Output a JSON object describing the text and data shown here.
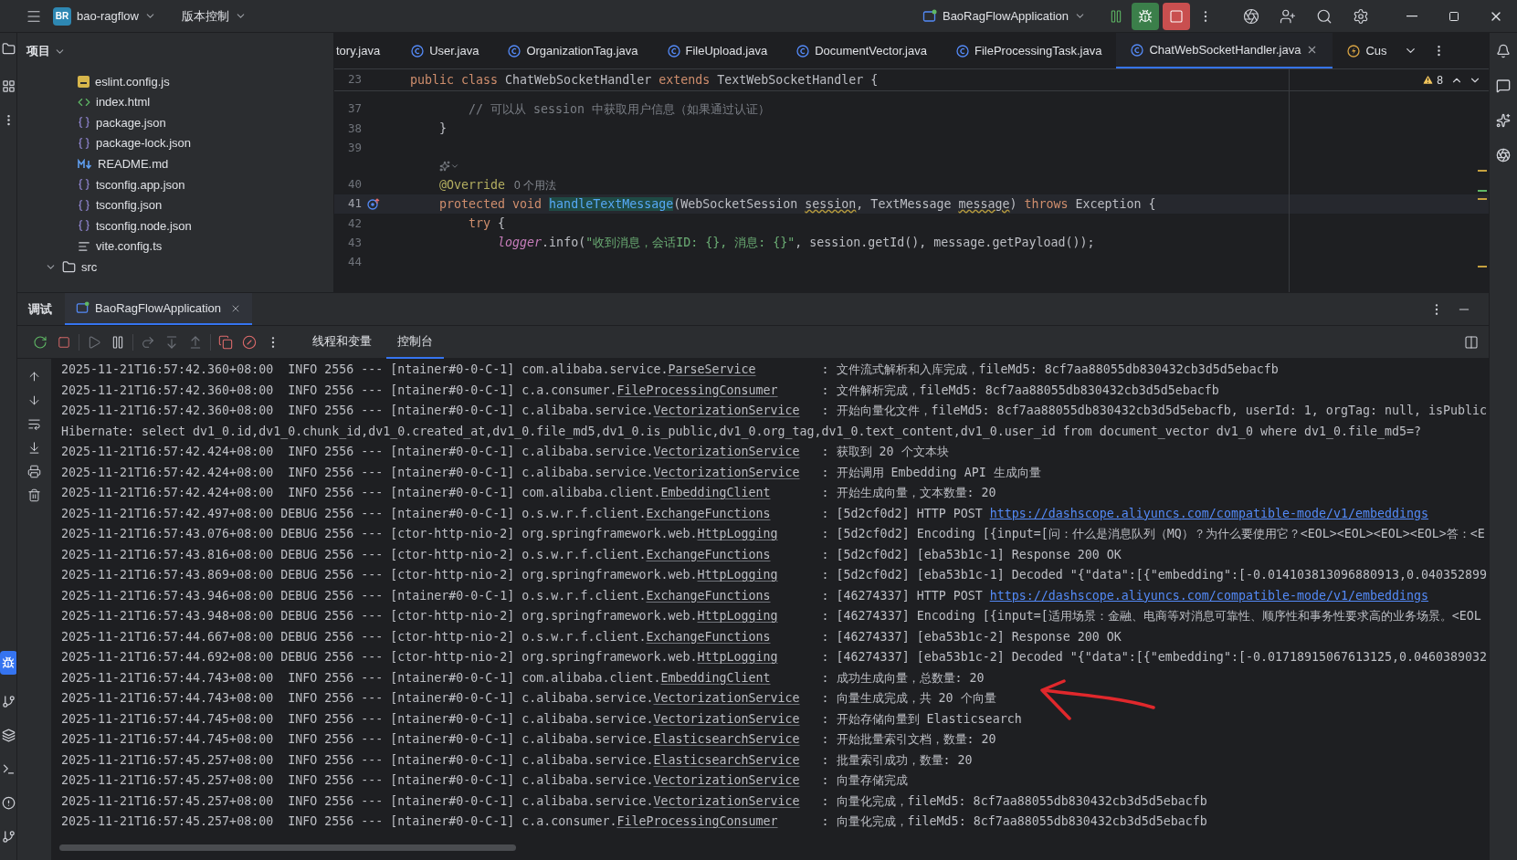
{
  "top_bar": {
    "project_badge": "BR",
    "project": "bao-ragflow",
    "vcs": "版本控制",
    "run_config": "BaoRagFlowApplication"
  },
  "project_panel": {
    "title": "项目",
    "tree": [
      {
        "kind": "js",
        "label": "eslint.config.js"
      },
      {
        "kind": "html",
        "label": "index.html"
      },
      {
        "kind": "json",
        "label": "package.json"
      },
      {
        "kind": "json",
        "label": "package-lock.json"
      },
      {
        "kind": "md",
        "label": "README.md"
      },
      {
        "kind": "json",
        "label": "tsconfig.app.json"
      },
      {
        "kind": "json",
        "label": "tsconfig.json"
      },
      {
        "kind": "json",
        "label": "tsconfig.node.json"
      },
      {
        "kind": "config",
        "label": "vite.config.ts"
      },
      {
        "kind": "folder",
        "label": "src",
        "expanded": true
      }
    ]
  },
  "editor": {
    "tabs": [
      {
        "label": "tory.java",
        "kind": "plain",
        "selected": false
      },
      {
        "label": "User.java",
        "kind": "class",
        "selected": false
      },
      {
        "label": "OrganizationTag.java",
        "kind": "class",
        "selected": false
      },
      {
        "label": "FileUpload.java",
        "kind": "class",
        "selected": false
      },
      {
        "label": "DocumentVector.java",
        "kind": "class",
        "selected": false
      },
      {
        "label": "FileProcessingTask.java",
        "kind": "class",
        "selected": false
      },
      {
        "label": "ChatWebSocketHandler.java",
        "kind": "class",
        "selected": true
      },
      {
        "label": "Cus",
        "kind": "bolt",
        "selected": false
      }
    ],
    "warnings": "8",
    "sticky_line": {
      "number": "23",
      "tokens": [
        {
          "kind": "keyword",
          "text": "public class "
        },
        {
          "kind": "plain",
          "text": "ChatWebSocketHandler "
        },
        {
          "kind": "keyword",
          "text": "extends "
        },
        {
          "kind": "plain",
          "text": "TextWebSocketHandler {"
        }
      ]
    },
    "lines": [
      {
        "kind": "code",
        "number": "37",
        "current": false,
        "override": false,
        "tokens": [
          {
            "kind": "comment",
            "text": "        // 可以从 session 中获取用户信息（如果通过认证）"
          }
        ]
      },
      {
        "kind": "code",
        "number": "38",
        "current": false,
        "override": false,
        "tokens": [
          {
            "kind": "plain",
            "text": "    }"
          }
        ]
      },
      {
        "kind": "code",
        "number": "39",
        "current": false,
        "override": false
      },
      {
        "kind": "inlay"
      },
      {
        "kind": "code",
        "number": "40",
        "current": false,
        "override": false,
        "tokens": [
          {
            "kind": "annotation",
            "text": "    @Override"
          },
          {
            "kind": "hint",
            "text": "0 个用法"
          }
        ]
      },
      {
        "kind": "code",
        "number": "41",
        "current": true,
        "override": true,
        "tokens": [
          {
            "kind": "keyword",
            "text": "    protected void "
          },
          {
            "kind": "method",
            "text": "handleTextMessage"
          },
          {
            "kind": "plain",
            "text": "(WebSocketSession "
          },
          {
            "kind": "warn",
            "text": "session"
          },
          {
            "kind": "plain",
            "text": ", TextMessage "
          },
          {
            "kind": "warn",
            "text": "message"
          },
          {
            "kind": "plain",
            "text": ") "
          },
          {
            "kind": "keyword",
            "text": "throws"
          },
          {
            "kind": "plain",
            "text": " Exception {"
          }
        ]
      },
      {
        "kind": "code",
        "number": "42",
        "current": false,
        "override": false,
        "tokens": [
          {
            "kind": "keyword",
            "text": "        try"
          },
          {
            "kind": "plain",
            "text": " {"
          }
        ]
      },
      {
        "kind": "code",
        "number": "43",
        "current": false,
        "override": false,
        "tokens": [
          {
            "kind": "field",
            "text": "            logger"
          },
          {
            "kind": "plain",
            "text": ".info("
          },
          {
            "kind": "string",
            "text": "\"收到消息，会话ID: {}, 消息: {}\""
          },
          {
            "kind": "plain",
            "text": ", session.getId(), message.getPayload());"
          }
        ]
      },
      {
        "kind": "code",
        "number": "44",
        "current": false,
        "override": false
      }
    ]
  },
  "debug_panel": {
    "title": "调试",
    "tabs": [
      {
        "label": "BaoRagFlowApplication",
        "selected": true
      }
    ],
    "subtabs": [
      {
        "label": "线程和变量",
        "selected": false
      },
      {
        "label": "控制台",
        "selected": true
      }
    ],
    "console": [
      {
        "kind": "log",
        "head": "2025-11-21T16:57:42.360+08:00  INFO 2556 --- [ntainer#0-0-C-1]",
        "pkg": "com.alibaba.service.",
        "cls": "ParseService",
        "message": ": 文件流式解析和入库完成，fileMd5: 8cf7aa88055db830432cb3d5d5ebacfb"
      },
      {
        "kind": "log",
        "head": "2025-11-21T16:57:42.360+08:00  INFO 2556 --- [ntainer#0-0-C-1]",
        "pkg": "c.a.consumer.",
        "cls": "FileProcessingConsumer",
        "message": ": 文件解析完成，fileMd5: 8cf7aa88055db830432cb3d5d5ebacfb"
      },
      {
        "kind": "log",
        "head": "2025-11-21T16:57:42.360+08:00  INFO 2556 --- [ntainer#0-0-C-1]",
        "pkg": "c.alibaba.service.",
        "cls": "VectorizationService",
        "message": ": 开始向量化文件，fileMd5: 8cf7aa88055db830432cb3d5d5ebacfb, userId: 1, orgTag: null, isPublic"
      },
      {
        "kind": "sql",
        "text": "Hibernate: select dv1_0.id,dv1_0.chunk_id,dv1_0.created_at,dv1_0.file_md5,dv1_0.is_public,dv1_0.org_tag,dv1_0.text_content,dv1_0.user_id from document_vector dv1_0 where dv1_0.file_md5=?"
      },
      {
        "kind": "log",
        "head": "2025-11-21T16:57:42.424+08:00  INFO 2556 --- [ntainer#0-0-C-1]",
        "pkg": "c.alibaba.service.",
        "cls": "VectorizationService",
        "message": ": 获取到 20 个文本块"
      },
      {
        "kind": "log",
        "head": "2025-11-21T16:57:42.424+08:00  INFO 2556 --- [ntainer#0-0-C-1]",
        "pkg": "c.alibaba.service.",
        "cls": "VectorizationService",
        "message": ": 开始调用 Embedding API 生成向量"
      },
      {
        "kind": "log",
        "head": "2025-11-21T16:57:42.424+08:00  INFO 2556 --- [ntainer#0-0-C-1]",
        "pkg": "com.alibaba.client.",
        "cls": "EmbeddingClient",
        "message": ": 开始生成向量，文本数量: 20"
      },
      {
        "kind": "log",
        "head": "2025-11-21T16:57:42.497+08:00 DEBUG 2556 --- [ntainer#0-0-C-1]",
        "pkg": "o.s.w.r.f.client.",
        "cls": "ExchangeFunctions",
        "message": ": [5d2cf0d2] HTTP POST ",
        "link": "https://dashscope.aliyuncs.com/compatible-mode/v1/embeddings"
      },
      {
        "kind": "log",
        "head": "2025-11-21T16:57:43.076+08:00 DEBUG 2556 --- [ctor-http-nio-2]",
        "pkg": "org.springframework.web.",
        "cls": "HttpLogging",
        "message": ": [5d2cf0d2] Encoding [{input=[问：什么是消息队列（MQ）？为什么要使用它？<EOL><EOL><EOL><EOL>答：<E"
      },
      {
        "kind": "log",
        "head": "2025-11-21T16:57:43.816+08:00 DEBUG 2556 --- [ctor-http-nio-2]",
        "pkg": "o.s.w.r.f.client.",
        "cls": "ExchangeFunctions",
        "message": ": [5d2cf0d2] [eba53b1c-1] Response 200 OK"
      },
      {
        "kind": "log",
        "head": "2025-11-21T16:57:43.869+08:00 DEBUG 2556 --- [ctor-http-nio-2]",
        "pkg": "org.springframework.web.",
        "cls": "HttpLogging",
        "message": ": [5d2cf0d2] [eba53b1c-1] Decoded \"{\"data\":[{\"embedding\":[-0.014103813096880913,0.040352899"
      },
      {
        "kind": "log",
        "head": "2025-11-21T16:57:43.946+08:00 DEBUG 2556 --- [ntainer#0-0-C-1]",
        "pkg": "o.s.w.r.f.client.",
        "cls": "ExchangeFunctions",
        "message": ": [46274337] HTTP POST ",
        "link": "https://dashscope.aliyuncs.com/compatible-mode/v1/embeddings"
      },
      {
        "kind": "log",
        "head": "2025-11-21T16:57:43.948+08:00 DEBUG 2556 --- [ctor-http-nio-2]",
        "pkg": "org.springframework.web.",
        "cls": "HttpLogging",
        "message": ": [46274337] Encoding [{input=[适用场景：金融、电商等对消息可靠性、顺序性和事务性要求高的业务场景。<EOL"
      },
      {
        "kind": "log",
        "head": "2025-11-21T16:57:44.667+08:00 DEBUG 2556 --- [ctor-http-nio-2]",
        "pkg": "o.s.w.r.f.client.",
        "cls": "ExchangeFunctions",
        "message": ": [46274337] [eba53b1c-2] Response 200 OK"
      },
      {
        "kind": "log",
        "head": "2025-11-21T16:57:44.692+08:00 DEBUG 2556 --- [ctor-http-nio-2]",
        "pkg": "org.springframework.web.",
        "cls": "HttpLogging",
        "message": ": [46274337] [eba53b1c-2] Decoded \"{\"data\":[{\"embedding\":[-0.01718915067613125,0.0460389032"
      },
      {
        "kind": "log",
        "head": "2025-11-21T16:57:44.743+08:00  INFO 2556 --- [ntainer#0-0-C-1]",
        "pkg": "com.alibaba.client.",
        "cls": "EmbeddingClient",
        "message": ": 成功生成向量，总数量: 20"
      },
      {
        "kind": "log",
        "head": "2025-11-21T16:57:44.743+08:00  INFO 2556 --- [ntainer#0-0-C-1]",
        "pkg": "c.alibaba.service.",
        "cls": "VectorizationService",
        "message": ": 向量生成完成，共 20 个向量"
      },
      {
        "kind": "log",
        "head": "2025-11-21T16:57:44.745+08:00  INFO 2556 --- [ntainer#0-0-C-1]",
        "pkg": "c.alibaba.service.",
        "cls": "VectorizationService",
        "message": ": 开始存储向量到 Elasticsearch"
      },
      {
        "kind": "log",
        "head": "2025-11-21T16:57:44.745+08:00  INFO 2556 --- [ntainer#0-0-C-1]",
        "pkg": "c.alibaba.service.",
        "cls": "ElasticsearchService",
        "message": ": 开始批量索引文档，数量: 20"
      },
      {
        "kind": "log",
        "head": "2025-11-21T16:57:45.257+08:00  INFO 2556 --- [ntainer#0-0-C-1]",
        "pkg": "c.alibaba.service.",
        "cls": "ElasticsearchService",
        "message": ": 批量索引成功，数量: 20"
      },
      {
        "kind": "log",
        "head": "2025-11-21T16:57:45.257+08:00  INFO 2556 --- [ntainer#0-0-C-1]",
        "pkg": "c.alibaba.service.",
        "cls": "VectorizationService",
        "message": ": 向量存储完成"
      },
      {
        "kind": "log",
        "head": "2025-11-21T16:57:45.257+08:00  INFO 2556 --- [ntainer#0-0-C-1]",
        "pkg": "c.alibaba.service.",
        "cls": "VectorizationService",
        "message": ": 向量化完成，fileMd5: 8cf7aa88055db830432cb3d5d5ebacfb"
      },
      {
        "kind": "log",
        "head": "2025-11-21T16:57:45.257+08:00  INFO 2556 --- [ntainer#0-0-C-1]",
        "pkg": "c.a.consumer.",
        "cls": "FileProcessingConsumer",
        "message": ": 向量化完成，fileMd5: 8cf7aa88055db830432cb3d5d5ebacfb"
      }
    ]
  }
}
